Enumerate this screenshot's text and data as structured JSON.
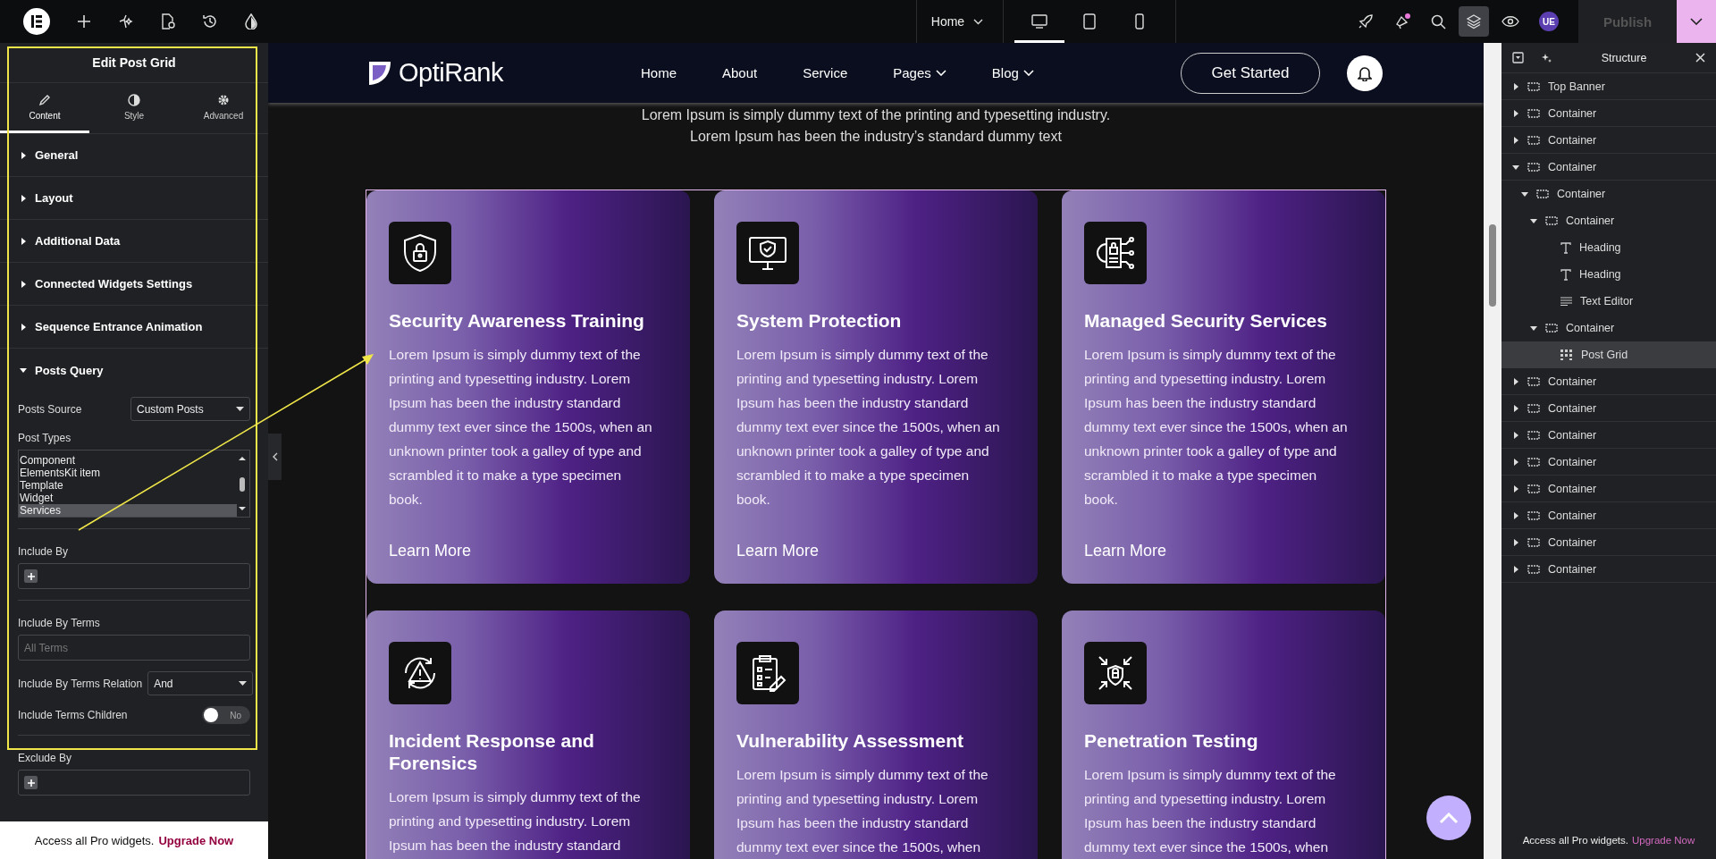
{
  "toolbar": {
    "page_selector": "Home",
    "devices": [
      {
        "kind": "desktop",
        "selected": true
      },
      {
        "kind": "tablet",
        "selected": false
      },
      {
        "kind": "mobile",
        "selected": false
      }
    ],
    "publish": {
      "label": "Publish",
      "disabled": true
    },
    "user_initials": "UE",
    "layers_selected": true,
    "notification_dot": true
  },
  "panel": {
    "title": "Edit Post Grid",
    "tabs": [
      {
        "label": "Content",
        "kind": "content",
        "selected": true
      },
      {
        "label": "Style",
        "kind": "style",
        "selected": false
      },
      {
        "label": "Advanced",
        "kind": "advanced",
        "selected": false
      }
    ],
    "sections": [
      {
        "label": "General",
        "expanded": false
      },
      {
        "label": "Layout",
        "expanded": false
      },
      {
        "label": "Additional Data",
        "expanded": false
      },
      {
        "label": "Connected Widgets Settings",
        "expanded": false
      },
      {
        "label": "Sequence Entrance Animation",
        "expanded": false
      },
      {
        "label": "Posts Query",
        "expanded": true
      }
    ],
    "fields": [
      {
        "kind": "select",
        "label": "Posts Source",
        "value": "Custom Posts"
      },
      {
        "kind": "listbox",
        "label": "Post Types",
        "options": [
          {
            "label": "Component",
            "selected": false
          },
          {
            "label": "ElementsKit item",
            "selected": false
          },
          {
            "label": "Template",
            "selected": false
          },
          {
            "label": "Widget",
            "selected": false
          },
          {
            "label": "Services",
            "selected": true
          }
        ]
      },
      {
        "kind": "add",
        "label": "Include By"
      },
      {
        "kind": "text",
        "label": "Include By Terms",
        "placeholder": "All Terms"
      },
      {
        "kind": "select",
        "label": "Include By Terms Relation",
        "value": "And"
      },
      {
        "kind": "toggle",
        "label": "Include Terms Children",
        "on": false,
        "state_text": "No"
      },
      {
        "kind": "add",
        "label": "Exclude By"
      }
    ],
    "promo": {
      "text": "Access all Pro widgets.",
      "link": "Upgrade Now"
    }
  },
  "site": {
    "logo": "OptiRank",
    "nav": [
      {
        "label": "Home",
        "dropdown": false
      },
      {
        "label": "About",
        "dropdown": false
      },
      {
        "label": "Service",
        "dropdown": false
      },
      {
        "label": "Pages",
        "dropdown": true
      },
      {
        "label": "Blog",
        "dropdown": true
      }
    ],
    "cta": "Get Started",
    "intro": [
      "Lorem Ipsum is simply dummy text of the printing and typesetting industry.",
      "Lorem Ipsum has been the industry’s standard dummy text"
    ],
    "cards": [
      {
        "title": "Security Awareness Training",
        "text": "Lorem Ipsum is simply dummy text of the printing and typesetting industry. Lorem Ipsum has been the industry standard dummy text ever since the 1500s, when an unknown printer took a galley of type and scrambled it to make a type specimen book.",
        "link": "Learn More"
      },
      {
        "title": "System Protection",
        "text": "Lorem Ipsum is simply dummy text of the printing and typesetting industry. Lorem Ipsum has been the industry standard dummy text ever since the 1500s, when an unknown printer took a galley of type and scrambled it to make a type specimen book.",
        "link": "Learn More"
      },
      {
        "title": "Managed Security Services",
        "text": "Lorem Ipsum is simply dummy text of the printing and typesetting industry. Lorem Ipsum has been the industry standard dummy text ever since the 1500s, when an unknown printer took a galley of type and scrambled it to make a type specimen book.",
        "link": "Learn More"
      },
      {
        "title": "Incident Response and Forensics",
        "text": "Lorem Ipsum is simply dummy text of the printing and typesetting industry. Lorem Ipsum has been the industry standard"
      },
      {
        "title": "Vulnerability Assessment",
        "text": "Lorem Ipsum is simply dummy text of the printing and typesetting industry. Lorem Ipsum has been the industry standard dummy text ever since the 1500s, when"
      },
      {
        "title": "Penetration Testing",
        "text": "Lorem Ipsum is simply dummy text of the printing and typesetting industry. Lorem Ipsum has been the industry standard dummy text ever since the 1500s, when"
      }
    ]
  },
  "structure": {
    "title": "Structure",
    "items": [
      {
        "label": "Top Banner",
        "kind": "container",
        "expanded": false,
        "selected": false
      },
      {
        "label": "Container",
        "kind": "container",
        "expanded": false,
        "selected": false
      },
      {
        "label": "Container",
        "kind": "container",
        "expanded": false,
        "selected": false
      },
      {
        "label": "Container",
        "kind": "container",
        "expanded": true,
        "selected": false,
        "children": [
          {
            "label": "Container",
            "kind": "container",
            "expanded": true,
            "selected": false,
            "children": [
              {
                "label": "Container",
                "kind": "container",
                "expanded": true,
                "selected": false,
                "children": [
                  {
                    "label": "Heading",
                    "kind": "heading",
                    "selected": false
                  },
                  {
                    "label": "Heading",
                    "kind": "heading",
                    "selected": false
                  },
                  {
                    "label": "Text Editor",
                    "kind": "text",
                    "selected": false
                  }
                ]
              },
              {
                "label": "Container",
                "kind": "container",
                "expanded": true,
                "selected": false,
                "children": [
                  {
                    "label": "Post Grid",
                    "kind": "grid",
                    "selected": true
                  }
                ]
              }
            ]
          }
        ]
      },
      {
        "label": "Container",
        "kind": "container",
        "expanded": false,
        "selected": false
      },
      {
        "label": "Container",
        "kind": "container",
        "expanded": false,
        "selected": false
      },
      {
        "label": "Container",
        "kind": "container",
        "expanded": false,
        "selected": false
      },
      {
        "label": "Container",
        "kind": "container",
        "expanded": false,
        "selected": false
      },
      {
        "label": "Container",
        "kind": "container",
        "expanded": false,
        "selected": false
      },
      {
        "label": "Container",
        "kind": "container",
        "expanded": false,
        "selected": false
      },
      {
        "label": "Container",
        "kind": "container",
        "expanded": false,
        "selected": false
      },
      {
        "label": "Container",
        "kind": "container",
        "expanded": false,
        "selected": false
      }
    ],
    "promo": {
      "text": "Access all Pro widgets.",
      "link": "Upgrade Now"
    }
  }
}
